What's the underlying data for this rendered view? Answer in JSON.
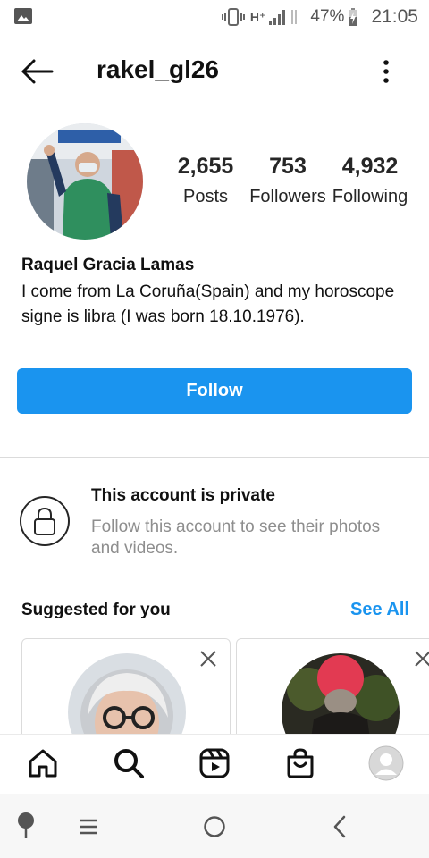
{
  "status_bar": {
    "network": "H⁺",
    "battery": "47%",
    "time": "21:05"
  },
  "header": {
    "username": "rakel_gl26"
  },
  "profile": {
    "stats": [
      {
        "value": "2,655",
        "label": "Posts"
      },
      {
        "value": "753",
        "label": "Followers"
      },
      {
        "value": "4,932",
        "label": "Following"
      }
    ],
    "full_name": "Raquel Gracia Lamas",
    "bio": "I come from La Coruña(Spain) and my horoscope signe is libra (I was born 18.10.1976).",
    "follow_label": "Follow"
  },
  "private": {
    "title": "This account is private",
    "description": "Follow this account to see their photos and videos."
  },
  "suggested": {
    "title": "Suggested for you",
    "see_all": "See All"
  },
  "colors": {
    "accent": "#1a94ef",
    "text": "#262626",
    "muted": "#8e8e8e"
  },
  "bottom_nav": [
    "home-icon",
    "search-icon",
    "reels-icon",
    "shop-icon",
    "profile-avatar"
  ],
  "system_nav": [
    "assistant-icon",
    "recents-icon",
    "home-circle-icon",
    "back-chevron-icon"
  ]
}
